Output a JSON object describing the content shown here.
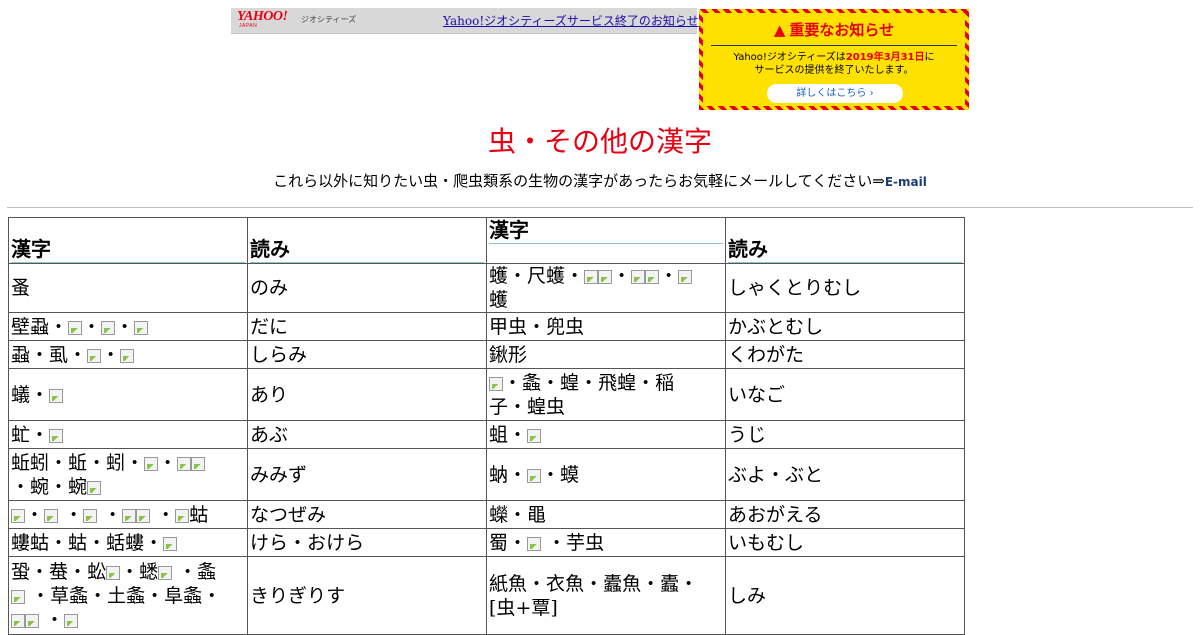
{
  "yahoo_bar": {
    "logo": "YAHOO!",
    "logo_sub": "JAPAN",
    "brand": "ジオシティーズ",
    "link": "Yahoo!ジオシティーズサービス終了のお知らせ"
  },
  "notice": {
    "title": "重要なお知らせ",
    "body_prefix": "Yahoo!ジオシティーズは",
    "body_date": "2019年3月31日",
    "body_suffix": "に",
    "body_line2": "サービスの提供を終了いたします。",
    "button": "詳しくはこちら ›"
  },
  "page": {
    "title": "虫・その他の漢字",
    "subtitle": "これら以外に知りたい虫・爬虫類系の生物の漢字があったらお気軽にメールしてください⇒",
    "email": "E-mail"
  },
  "table": {
    "headers": [
      "漢字",
      "読み",
      "漢字",
      "読み"
    ],
    "rows": [
      {
        "k1": "蚤",
        "r1": "のみ",
        "k2": "蠖・尺蠖・▣▣・▣▣・▣\n蠖",
        "r2": "しゃくとりむし"
      },
      {
        "k1": "壁蝨・▣・▣・▣",
        "r1": "だに",
        "k2": "甲虫・兜虫",
        "r2": "かぶとむし"
      },
      {
        "k1": "蝨・虱・▣・▣",
        "r1": "しらみ",
        "k2": "鍬形",
        "r2": "くわがた"
      },
      {
        "k1": "蟻・▣",
        "r1": "あり",
        "k2": "▣・螽・蝗・飛蝗・稲\n子・蝗虫",
        "r2": "いなご"
      },
      {
        "k1": "虻・▣",
        "r1": "あぶ",
        "k2": "蛆・▣",
        "r2": "うじ"
      },
      {
        "k1": "蚯蚓・蚯・蚓・▣・▣▣\n・蜿・蜿▣",
        "r1": "みみず",
        "k2": "蚋・▣・蟆",
        "r2": "ぶよ・ぶと"
      },
      {
        "k1": "▣・▣ ・▣ ・▣▣ ・▣蛄",
        "r1": "なつぜみ",
        "k2": "蠑・黽",
        "r2": "あおがえる"
      },
      {
        "k1": "螻蛄・蛄・蛞螻・▣",
        "r1": "けら・おけら",
        "k2": "蜀・▣ ・芋虫",
        "r2": "いもむし"
      },
      {
        "k1": "蛩・蛬・蚣▣・蟋▣ ・螽\n▣ ・草螽・土螽・阜螽・\n▣▣ ・▣",
        "r1": "きりぎりす",
        "k2": "紙魚・衣魚・蠹魚・蠹・\n[虫+覃]",
        "r2": "しみ"
      }
    ]
  }
}
